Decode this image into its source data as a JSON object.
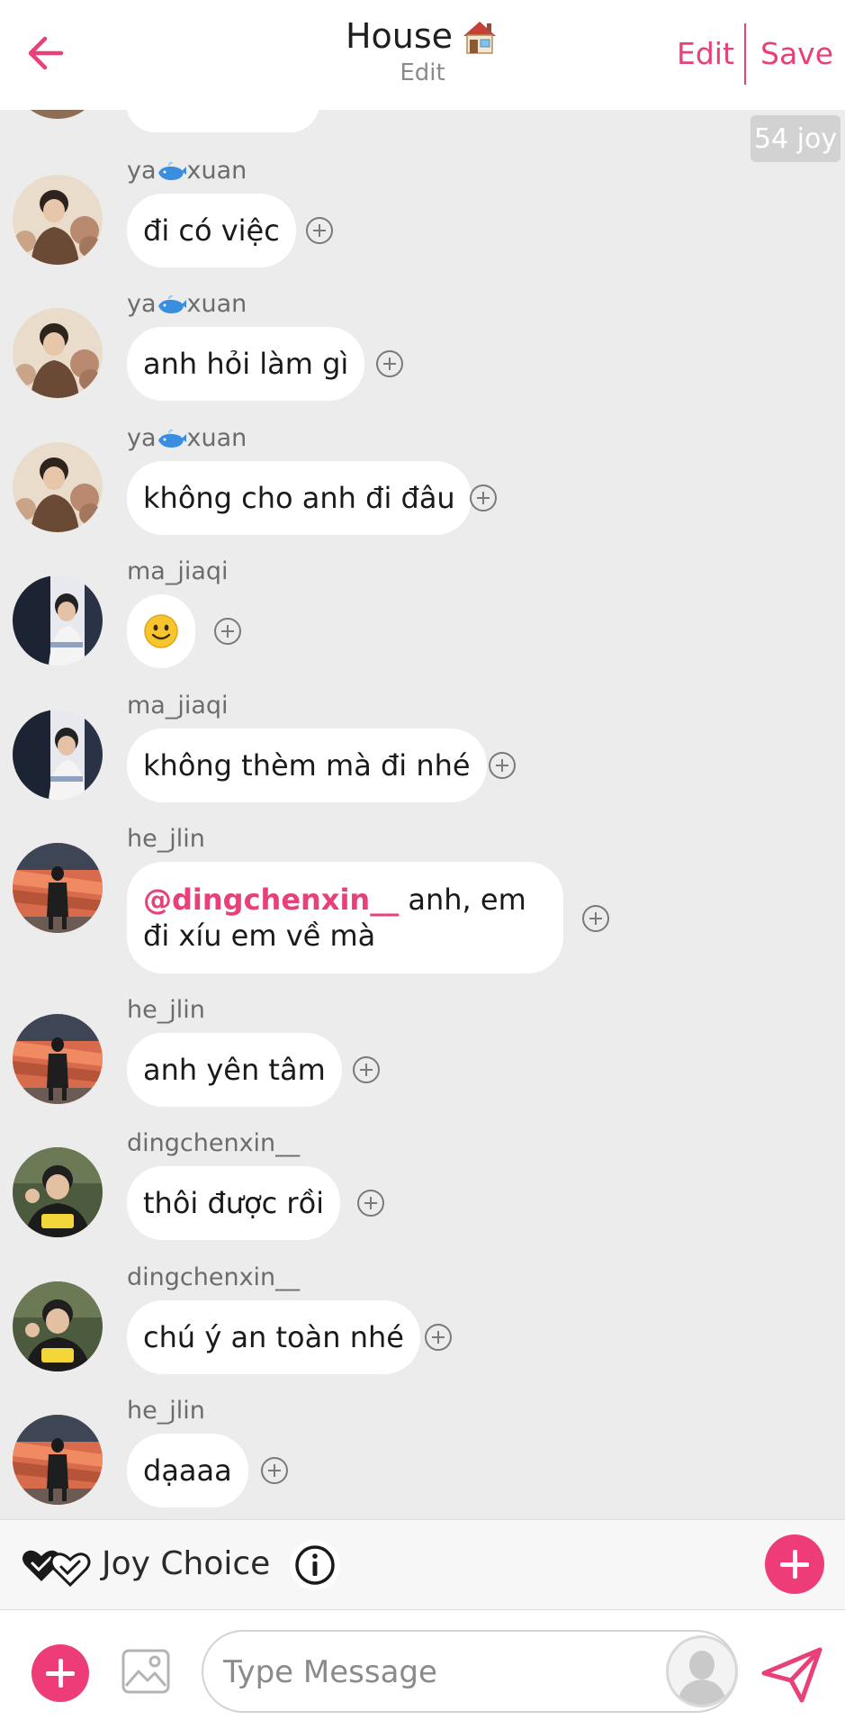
{
  "header": {
    "title": "House",
    "title_icon": "house-icon",
    "subtitle": "Edit",
    "edit_label": "Edit",
    "save_label": "Save",
    "accent_color": "#e8407a"
  },
  "joy_badge": "54 joy",
  "messages": [
    {
      "username_prefix": "ya",
      "username_suffix": "xuan",
      "username_icon": "whale-icon",
      "text": "đi có việc"
    },
    {
      "username_prefix": "ya",
      "username_suffix": "xuan",
      "username_icon": "whale-icon",
      "text": "anh hỏi làm gì"
    },
    {
      "username_prefix": "ya",
      "username_suffix": "xuan",
      "username_icon": "whale-icon",
      "text": "không cho anh đi đâu"
    },
    {
      "username": "ma_jiaqi",
      "text_icon": "smiley-icon"
    },
    {
      "username": "ma_jiaqi",
      "text": "không thèm mà đi nhé"
    },
    {
      "username": "he_jlin",
      "mention": "@dingchenxin__",
      "text": " anh, em đi xíu em về mà"
    },
    {
      "username": "he_jlin",
      "text": "anh yên tâm"
    },
    {
      "username": "dingchenxin__",
      "text": "thôi được rồi"
    },
    {
      "username": "dingchenxin__",
      "text": "chú ý an toàn nhé"
    },
    {
      "username": "he_jlin",
      "text": "dạaaa"
    }
  ],
  "joy_choice": {
    "label": "Joy Choice",
    "icon": "hearts-check-icon",
    "info_icon": "info-icon",
    "add_icon": "plus-icon"
  },
  "input": {
    "placeholder": "Type Message",
    "add_icon": "plus-icon",
    "image_icon": "image-icon",
    "character_icon": "character-avatar-icon",
    "send_icon": "send-icon",
    "brand_color": "#ee3c78"
  }
}
